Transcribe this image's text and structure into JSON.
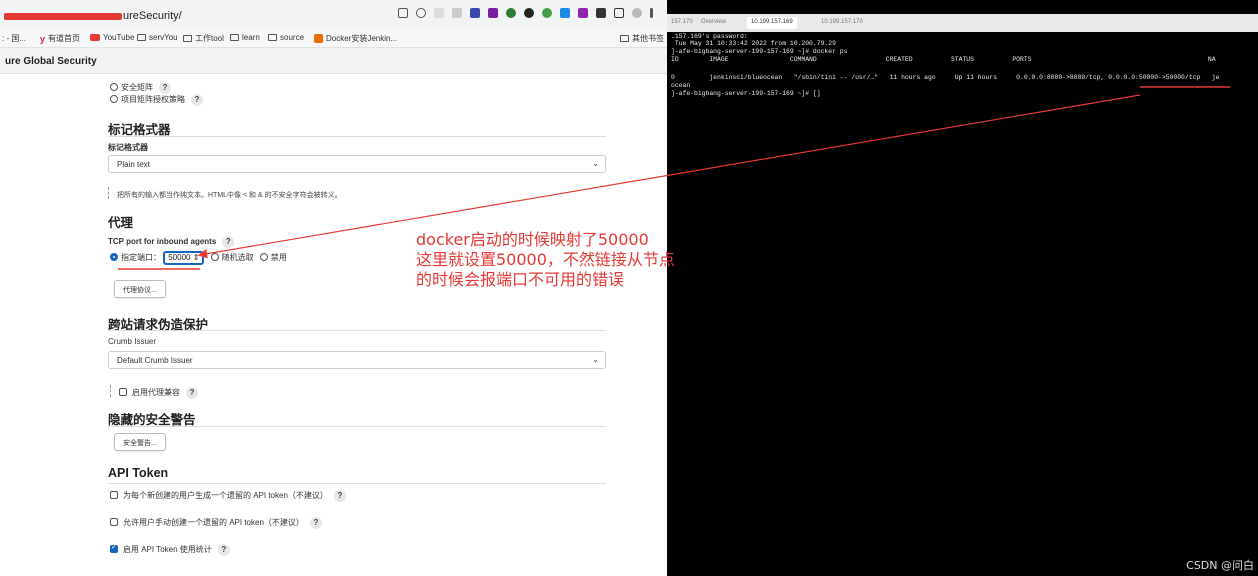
{
  "browser": {
    "url": "ureSecurity/",
    "bookmarks": [
      ": - 国...",
      "有道首页",
      "YouTube",
      "servYou",
      "工作tool",
      "learn",
      "source",
      "Docker安装Jenkin...",
      "其他书签"
    ],
    "page_title": "ure Global Security"
  },
  "security": {
    "options": [
      "安全矩阵",
      "项目矩阵授权策略"
    ]
  },
  "markup": {
    "title": "标记格式器",
    "label": "标记格式器",
    "value": "Plain text",
    "help": "把所有的输入都当作纯文本。HTML中像 < 和 & 的不安全字符会被转义。"
  },
  "agent": {
    "title": "代理",
    "port_label": "TCP port for inbound agents",
    "fixed_label": "指定端口：",
    "port_value": "50000",
    "random_label": "随机选取",
    "disable_label": "禁用",
    "protocol_button": "代理协议..."
  },
  "csrf": {
    "title": "跨站请求伪造保护",
    "issuer_label": "Crumb Issuer",
    "issuer_value": "Default Crumb Issuer",
    "proxy_compat": "启用代理兼容"
  },
  "hidden_warnings": {
    "title": "隐藏的安全警告",
    "button": "安全警告..."
  },
  "api_token": {
    "title": "API Token",
    "options": [
      "为每个新创建的用户生成一个遗留的 API token（不建议）",
      "允许用户手动创建一个遗留的 API token（不建议）",
      "启用 API Token 使用统计"
    ]
  },
  "terminal": {
    "tabs": [
      "157.170",
      "Overview",
      "10.199.157.169",
      "10.199.157.170"
    ],
    "lines": [
      ".157.169's password:",
      " Tue May 31 10:33:42 2022 from 10.200.79.29",
      "]-afe-bigbang-server-199-157-169 ~]# docker ps",
      "ID        IMAGE                COMMAND                  CREATED          STATUS          PORTS                                              NA",
      "0         jenkinsci/blueocean   \"/sbin/tini -- /usr/…\"   11 hours ago     Up 11 hours     0.0.0.0:8080->8080/tcp, 0.0.0.0:50000->50000/tcp   je",
      "ocean",
      "]-afe-bigbang-server-199-157-169 ~]# []"
    ]
  },
  "annotation": {
    "lines": [
      "docker启动的时候映射了50000",
      "这里就设置50000，不然链接从节点",
      "的时候会报端口不可用的错误"
    ],
    "color": "#e53935"
  },
  "watermark": "CSDN @问白"
}
